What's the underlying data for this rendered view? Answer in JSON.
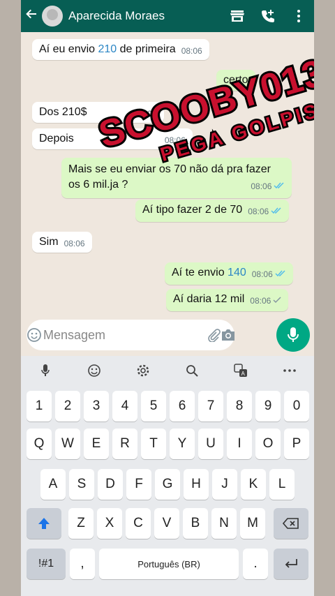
{
  "header": {
    "contact_name": "Aparecida Moraes"
  },
  "messages": [
    {
      "dir": "in",
      "text_pre": "Aí eu envio ",
      "num": "210",
      "text_post": " de primeira",
      "time": "08:06"
    },
    {
      "dir": "out",
      "text": "certo",
      "time": ""
    },
    {
      "dir": "in",
      "text": "Dos 210$",
      "time": "08:06"
    },
    {
      "dir": "in",
      "text": "Depois",
      "time": "08:06"
    },
    {
      "dir": "out",
      "text": "Mais se eu enviar os 70 não dá pra fazer",
      "text2": "os 6 mil.ja ?",
      "time": "08:06",
      "status": "read"
    },
    {
      "dir": "out",
      "text": "Aí tipo fazer 2 de 70",
      "time": "08:06",
      "status": "read"
    },
    {
      "dir": "in",
      "text": "Sim",
      "time": "08:06"
    },
    {
      "dir": "out",
      "text_pre": "Aí te envio ",
      "num": "140",
      "time": "08:06",
      "status": "read"
    },
    {
      "dir": "out",
      "text": "Aí daria 12 mil",
      "time": "08:06",
      "status": "sent"
    }
  ],
  "watermark": {
    "line1": "SCOOBY013",
    "line2": "PEGA GOLPISTA"
  },
  "composer": {
    "placeholder": "Mensagem"
  },
  "keyboard": {
    "row_numbers": [
      "1",
      "2",
      "3",
      "4",
      "5",
      "6",
      "7",
      "8",
      "9",
      "0"
    ],
    "row_1": [
      "Q",
      "W",
      "E",
      "R",
      "T",
      "Y",
      "U",
      "I",
      "O",
      "P"
    ],
    "row_2": [
      "A",
      "S",
      "D",
      "F",
      "G",
      "H",
      "J",
      "K",
      "L"
    ],
    "row_3": [
      "Z",
      "X",
      "C",
      "V",
      "B",
      "N",
      "M"
    ],
    "symbols_key": "!#1",
    "comma_key": ",",
    "space_label": "Português (BR)",
    "period_key": "."
  },
  "colors": {
    "header": "#075e54",
    "outgoing": "#dcf8c6",
    "accent": "#00a884",
    "read_ticks": "#53bdeb",
    "watermark": "#c8102e"
  }
}
